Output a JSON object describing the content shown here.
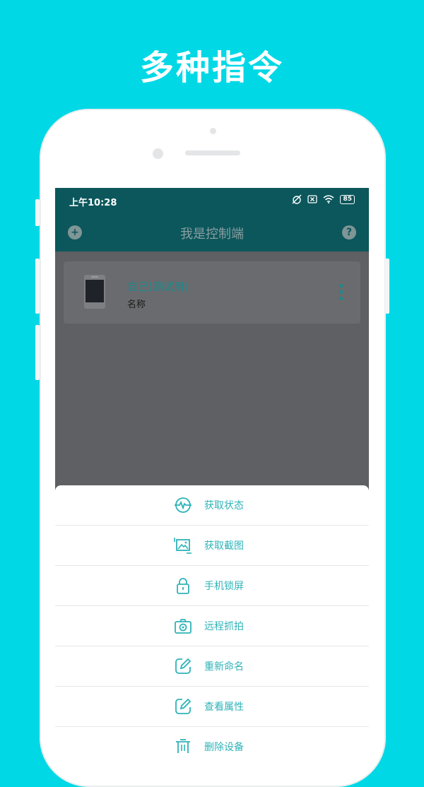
{
  "headline": "多种指令",
  "status_bar": {
    "time": "上午10:28",
    "battery": "85"
  },
  "app_bar": {
    "title": "我是控制端",
    "add_label": "+",
    "help_label": "?"
  },
  "device": {
    "name": "自己(测试用)",
    "subtitle": "名称"
  },
  "menu": {
    "items": [
      {
        "label": "获取状态",
        "icon": "pulse-icon"
      },
      {
        "label": "获取截图",
        "icon": "screenshot-icon"
      },
      {
        "label": "手机锁屏",
        "icon": "lock-icon"
      },
      {
        "label": "远程抓拍",
        "icon": "camera-icon"
      },
      {
        "label": "重新命名",
        "icon": "edit-icon"
      },
      {
        "label": "查看属性",
        "icon": "edit-icon"
      },
      {
        "label": "删除设备",
        "icon": "trash-icon"
      }
    ]
  },
  "colors": {
    "background": "#00d8e6",
    "toolbar": "#0b575c",
    "accent": "#2fb3b8"
  }
}
